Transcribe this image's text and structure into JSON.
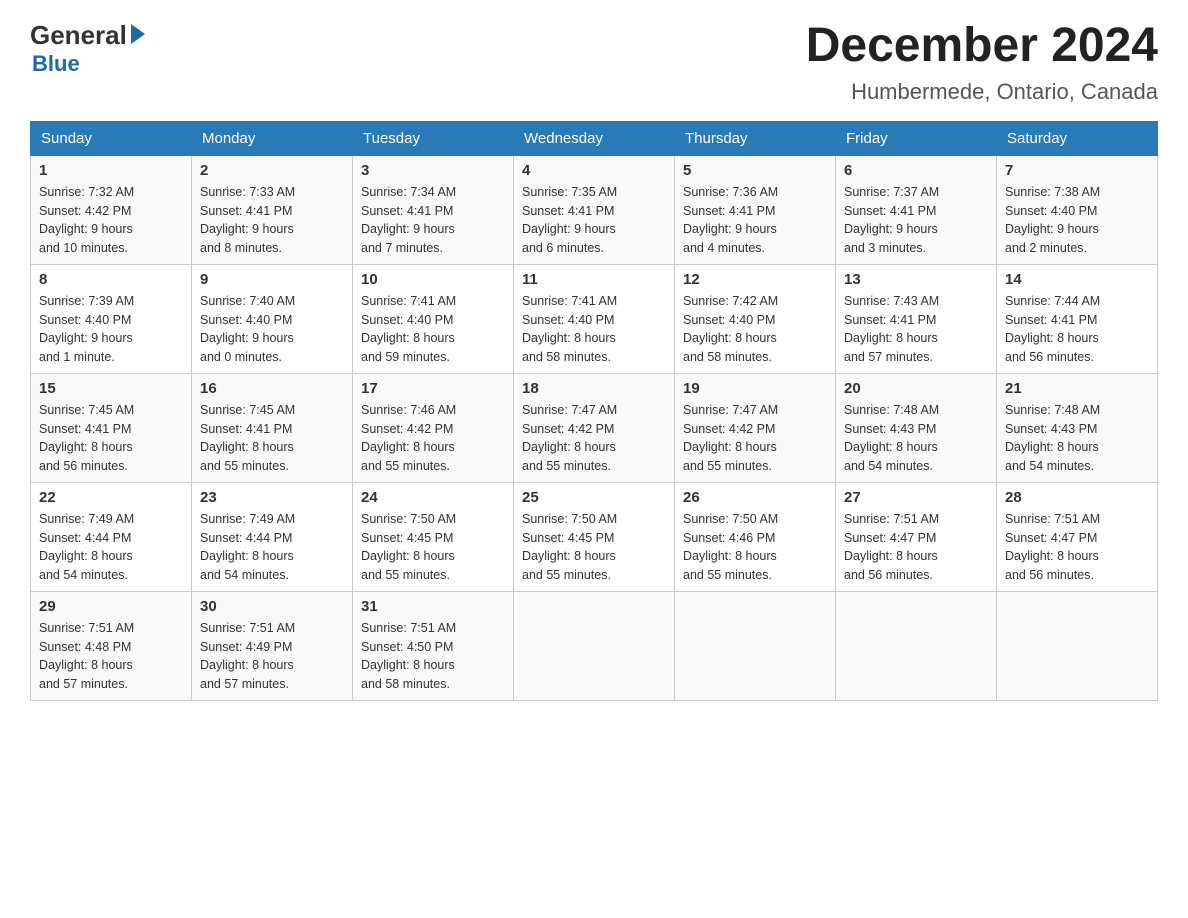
{
  "logo": {
    "general": "General",
    "blue": "Blue"
  },
  "calendar": {
    "title": "December 2024",
    "subtitle": "Humbermede, Ontario, Canada"
  },
  "weekdays": [
    "Sunday",
    "Monday",
    "Tuesday",
    "Wednesday",
    "Thursday",
    "Friday",
    "Saturday"
  ],
  "weeks": [
    [
      {
        "day": "1",
        "sunrise": "7:32 AM",
        "sunset": "4:42 PM",
        "daylight": "9 hours and 10 minutes."
      },
      {
        "day": "2",
        "sunrise": "7:33 AM",
        "sunset": "4:41 PM",
        "daylight": "9 hours and 8 minutes."
      },
      {
        "day": "3",
        "sunrise": "7:34 AM",
        "sunset": "4:41 PM",
        "daylight": "9 hours and 7 minutes."
      },
      {
        "day": "4",
        "sunrise": "7:35 AM",
        "sunset": "4:41 PM",
        "daylight": "9 hours and 6 minutes."
      },
      {
        "day": "5",
        "sunrise": "7:36 AM",
        "sunset": "4:41 PM",
        "daylight": "9 hours and 4 minutes."
      },
      {
        "day": "6",
        "sunrise": "7:37 AM",
        "sunset": "4:41 PM",
        "daylight": "9 hours and 3 minutes."
      },
      {
        "day": "7",
        "sunrise": "7:38 AM",
        "sunset": "4:40 PM",
        "daylight": "9 hours and 2 minutes."
      }
    ],
    [
      {
        "day": "8",
        "sunrise": "7:39 AM",
        "sunset": "4:40 PM",
        "daylight": "9 hours and 1 minute."
      },
      {
        "day": "9",
        "sunrise": "7:40 AM",
        "sunset": "4:40 PM",
        "daylight": "9 hours and 0 minutes."
      },
      {
        "day": "10",
        "sunrise": "7:41 AM",
        "sunset": "4:40 PM",
        "daylight": "8 hours and 59 minutes."
      },
      {
        "day": "11",
        "sunrise": "7:41 AM",
        "sunset": "4:40 PM",
        "daylight": "8 hours and 58 minutes."
      },
      {
        "day": "12",
        "sunrise": "7:42 AM",
        "sunset": "4:40 PM",
        "daylight": "8 hours and 58 minutes."
      },
      {
        "day": "13",
        "sunrise": "7:43 AM",
        "sunset": "4:41 PM",
        "daylight": "8 hours and 57 minutes."
      },
      {
        "day": "14",
        "sunrise": "7:44 AM",
        "sunset": "4:41 PM",
        "daylight": "8 hours and 56 minutes."
      }
    ],
    [
      {
        "day": "15",
        "sunrise": "7:45 AM",
        "sunset": "4:41 PM",
        "daylight": "8 hours and 56 minutes."
      },
      {
        "day": "16",
        "sunrise": "7:45 AM",
        "sunset": "4:41 PM",
        "daylight": "8 hours and 55 minutes."
      },
      {
        "day": "17",
        "sunrise": "7:46 AM",
        "sunset": "4:42 PM",
        "daylight": "8 hours and 55 minutes."
      },
      {
        "day": "18",
        "sunrise": "7:47 AM",
        "sunset": "4:42 PM",
        "daylight": "8 hours and 55 minutes."
      },
      {
        "day": "19",
        "sunrise": "7:47 AM",
        "sunset": "4:42 PM",
        "daylight": "8 hours and 55 minutes."
      },
      {
        "day": "20",
        "sunrise": "7:48 AM",
        "sunset": "4:43 PM",
        "daylight": "8 hours and 54 minutes."
      },
      {
        "day": "21",
        "sunrise": "7:48 AM",
        "sunset": "4:43 PM",
        "daylight": "8 hours and 54 minutes."
      }
    ],
    [
      {
        "day": "22",
        "sunrise": "7:49 AM",
        "sunset": "4:44 PM",
        "daylight": "8 hours and 54 minutes."
      },
      {
        "day": "23",
        "sunrise": "7:49 AM",
        "sunset": "4:44 PM",
        "daylight": "8 hours and 54 minutes."
      },
      {
        "day": "24",
        "sunrise": "7:50 AM",
        "sunset": "4:45 PM",
        "daylight": "8 hours and 55 minutes."
      },
      {
        "day": "25",
        "sunrise": "7:50 AM",
        "sunset": "4:45 PM",
        "daylight": "8 hours and 55 minutes."
      },
      {
        "day": "26",
        "sunrise": "7:50 AM",
        "sunset": "4:46 PM",
        "daylight": "8 hours and 55 minutes."
      },
      {
        "day": "27",
        "sunrise": "7:51 AM",
        "sunset": "4:47 PM",
        "daylight": "8 hours and 56 minutes."
      },
      {
        "day": "28",
        "sunrise": "7:51 AM",
        "sunset": "4:47 PM",
        "daylight": "8 hours and 56 minutes."
      }
    ],
    [
      {
        "day": "29",
        "sunrise": "7:51 AM",
        "sunset": "4:48 PM",
        "daylight": "8 hours and 57 minutes."
      },
      {
        "day": "30",
        "sunrise": "7:51 AM",
        "sunset": "4:49 PM",
        "daylight": "8 hours and 57 minutes."
      },
      {
        "day": "31",
        "sunrise": "7:51 AM",
        "sunset": "4:50 PM",
        "daylight": "8 hours and 58 minutes."
      },
      null,
      null,
      null,
      null
    ]
  ],
  "labels": {
    "sunrise": "Sunrise:",
    "sunset": "Sunset:",
    "daylight": "Daylight:"
  }
}
